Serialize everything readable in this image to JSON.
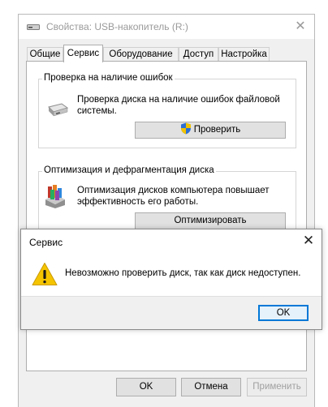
{
  "window": {
    "title": "Свойства: USB-накопитель (R:)",
    "close_glyph": "✕"
  },
  "tabs": [
    {
      "label": "Общие",
      "active": false
    },
    {
      "label": "Сервис",
      "active": true
    },
    {
      "label": "Оборудование",
      "active": false
    },
    {
      "label": "Доступ",
      "active": false
    },
    {
      "label": "Настройка",
      "active": false
    }
  ],
  "error_check": {
    "title": "Проверка на наличие ошибок",
    "description": "Проверка диска на наличие ошибок файловой системы.",
    "button_label": "Проверить"
  },
  "optimize": {
    "title": "Оптимизация и дефрагментация диска",
    "description": "Оптимизация дисков компьютера повышает эффективность его работы.",
    "button_label": "Оптимизировать"
  },
  "footer": {
    "ok_label": "OK",
    "cancel_label": "Отмена",
    "apply_label": "Применить"
  },
  "dialog": {
    "title": "Сервис",
    "close_glyph": "✕",
    "message": "Невозможно проверить диск, так как диск недоступен.",
    "ok_label": "OK",
    "icon": "warning-icon"
  },
  "colors": {
    "accent": "#0078d7",
    "warning": "#f5c400"
  }
}
